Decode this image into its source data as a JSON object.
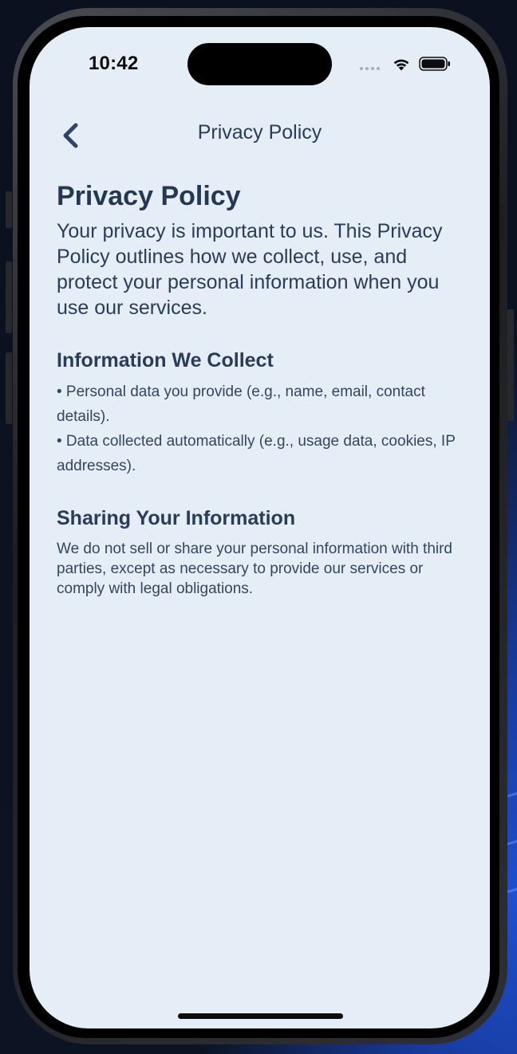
{
  "status_bar": {
    "time": "10:42",
    "icons": [
      "signal-dots-icon",
      "wifi-icon",
      "battery-icon"
    ]
  },
  "nav": {
    "back_icon": "chevron-left-icon",
    "title": "Privacy Policy"
  },
  "content": {
    "heading": "Privacy Policy",
    "intro": "Your privacy is important to us. This Privacy Policy outlines how we collect, use, and protect your personal information when you use our services.",
    "sections": [
      {
        "title": "Information We Collect",
        "bullets": [
          "• Personal data you provide (e.g., name, email, contact details).",
          "• Data collected automatically (e.g., usage data, cookies, IP addresses)."
        ]
      },
      {
        "title": "Sharing Your Information",
        "body": "We do not sell or share your personal information with third parties, except as necessary to provide our services or comply with legal obligations."
      }
    ]
  },
  "colors": {
    "screen_background": "#e5edf6",
    "text_primary": "#2a3c58",
    "accent": "#2a3c58"
  }
}
